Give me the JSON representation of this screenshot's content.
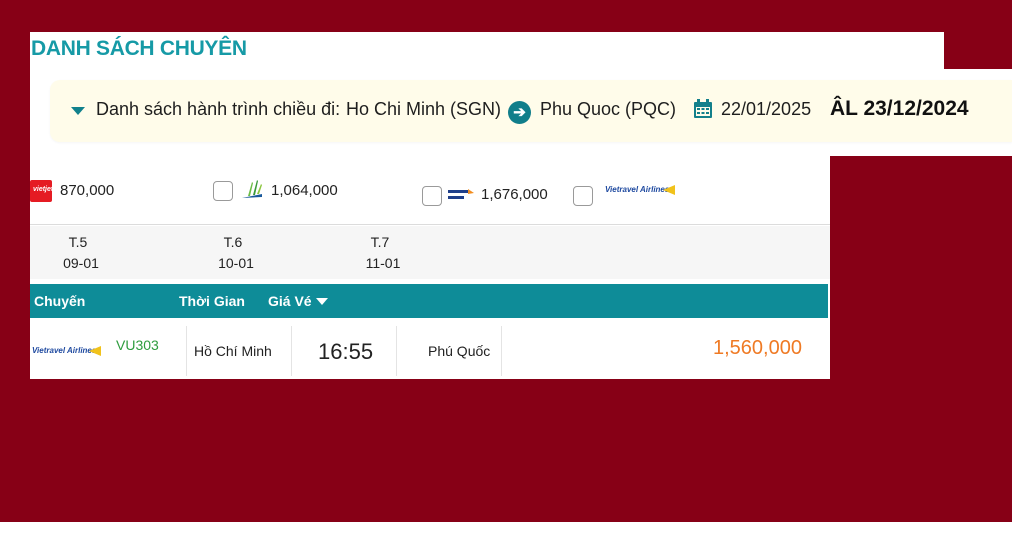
{
  "page": {
    "title": "DANH SÁCH CHUYÊN"
  },
  "itinerary": {
    "label": "Danh sách hành trình chiều đi:",
    "origin": "Ho Chi Minh (SGN)",
    "destination": "Phu Quoc (PQC)",
    "date": "22/01/2025",
    "lunar_date": "ÂL 23/12/2024"
  },
  "airline_filters": [
    {
      "airline_icon": "vietjet-logo",
      "price": "870,000"
    },
    {
      "airline_icon": "bamboo-logo",
      "price": "1,064,000"
    },
    {
      "airline_icon": "pacific-airlines-logo",
      "price": "1,676,000"
    },
    {
      "airline_icon": "vietravel-logo",
      "price": ""
    }
  ],
  "days": [
    {
      "weekday": "T.5",
      "date": "09-01"
    },
    {
      "weekday": "T.6",
      "date": "10-01"
    },
    {
      "weekday": "T.7",
      "date": "11-01"
    }
  ],
  "table": {
    "headers": {
      "flight": "Chuyến",
      "time": "Thời Gian",
      "price": "Giá Vé"
    },
    "rows": [
      {
        "airline_logo_text": "Vietravel Airlines",
        "flight_code": "VU303",
        "from": "Hồ Chí Minh",
        "departure": "16:55",
        "to": "Phú Quốc",
        "price": "1,560,000"
      }
    ]
  },
  "colors": {
    "background": "#870016",
    "teal": "#0e8c98",
    "price_orange": "#ef7a24",
    "flight_code_green": "#2e9c3e",
    "itinerary_bg": "#fffcea"
  }
}
